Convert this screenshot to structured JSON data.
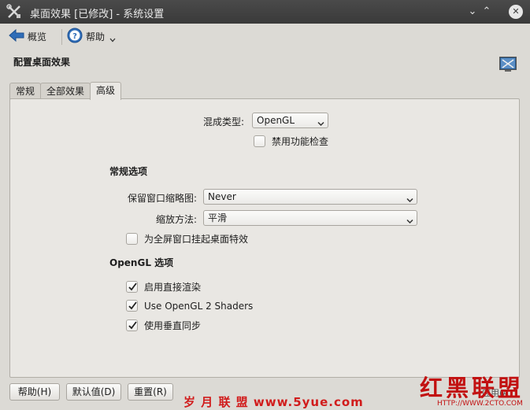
{
  "window": {
    "title": "桌面效果 [已修改] - 系统设置",
    "minimize": "⌄",
    "maximize": "⌃",
    "close": "✕"
  },
  "toolbar": {
    "overview_label": "概览",
    "help_label": "帮助"
  },
  "page": {
    "title": "配置桌面效果"
  },
  "tabs": [
    {
      "label": "常规"
    },
    {
      "label": "全部效果"
    },
    {
      "label": "高级"
    }
  ],
  "advanced": {
    "compositing_label": "混成类型:",
    "compositing_value": "OpenGL",
    "disable_checks_label": "禁用功能检查",
    "general_section": "常规选项",
    "thumbnails_label": "保留窗口缩略图:",
    "thumbnails_value": "Never",
    "scale_label": "缩放方法:",
    "scale_value": "平滑",
    "suspend_label": "为全屏窗口挂起桌面特效",
    "opengl_section": "OpenGL 选项",
    "direct_render_label": "启用直接渲染",
    "shaders_label": "Use OpenGL 2 Shaders",
    "vsync_label": "使用垂直同步"
  },
  "checks": {
    "disable_checks": false,
    "suspend": false,
    "direct_render": true,
    "shaders": true,
    "vsync": true
  },
  "footer": {
    "help": "帮助(H)",
    "defaults": "默认值(D)",
    "reset": "重置(R)",
    "apply_partial": "应用(A)"
  },
  "watermarks": {
    "left": "岁 月 联 盟   www.5yue.com",
    "right": "红黑联盟",
    "right_url": "HTTP://WWW.2CTO.COM"
  },
  "colors": {
    "titlebar": "#3f3f3f",
    "window_bg": "#dcdad5",
    "panel_bg": "#e9e7e3",
    "watermark": "#c21111"
  },
  "icons": {
    "app": "tools-icon",
    "back": "arrow-left-icon",
    "help": "help-icon",
    "corner": "desktop-effects-icon"
  }
}
